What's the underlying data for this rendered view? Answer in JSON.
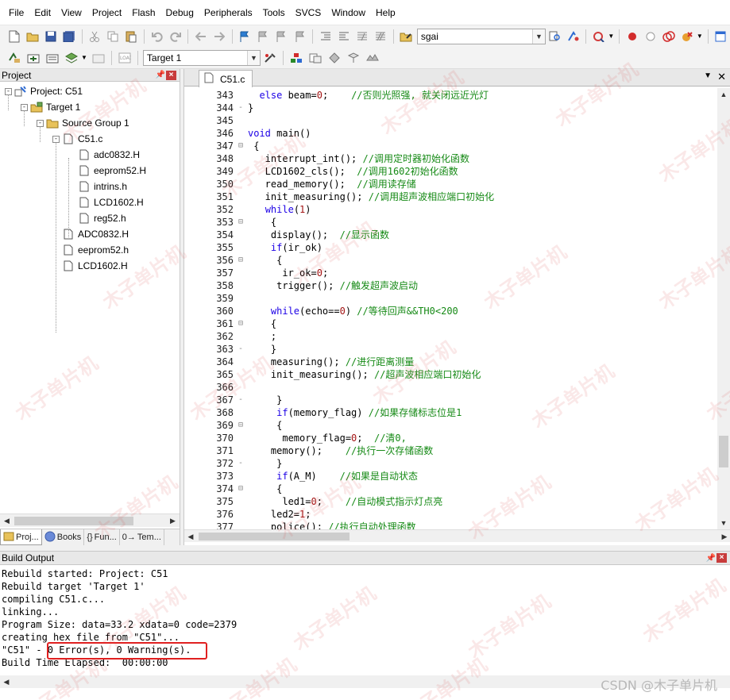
{
  "menu": [
    "File",
    "Edit",
    "View",
    "Project",
    "Flash",
    "Debug",
    "Peripherals",
    "Tools",
    "SVCS",
    "Window",
    "Help"
  ],
  "toolbar": {
    "find_combo": "sgai",
    "target_combo": "Target 1"
  },
  "project_panel": {
    "title": "Project",
    "tree": [
      {
        "label": "Project: C51",
        "icon": "project-icon",
        "expander": "-"
      },
      {
        "label": "Target 1",
        "icon": "target-icon",
        "expander": "-"
      },
      {
        "label": "Source Group 1",
        "icon": "folder-icon",
        "expander": "-"
      },
      {
        "label": "C51.c",
        "icon": "file-icon",
        "expander": "-"
      },
      {
        "label": "adc0832.H",
        "icon": "file-icon"
      },
      {
        "label": "eeprom52.H",
        "icon": "file-icon"
      },
      {
        "label": "intrins.h",
        "icon": "file-icon"
      },
      {
        "label": "LCD1602.H",
        "icon": "file-icon"
      },
      {
        "label": "reg52.h",
        "icon": "file-icon"
      },
      {
        "label": "ADC0832.H",
        "icon": "file-icon"
      },
      {
        "label": "eeprom52.h",
        "icon": "file-icon"
      },
      {
        "label": "LCD1602.H",
        "icon": "file-icon"
      }
    ],
    "tabs": [
      {
        "label": "Proj...",
        "icon": "project-tab-icon"
      },
      {
        "label": "Books",
        "icon": "books-icon"
      },
      {
        "label": "Fun...",
        "icon": "functions-icon",
        "glyph": "{}"
      },
      {
        "label": "Tem...",
        "icon": "templates-icon",
        "glyph": "0→"
      }
    ]
  },
  "editor": {
    "tab": "C51.c",
    "lines": [
      {
        "n": "343",
        "fold": "",
        "code": [
          {
            "t": "  "
          },
          {
            "t": "else",
            "c": "kw"
          },
          {
            "t": " beam="
          },
          {
            "t": "0",
            "c": "num"
          },
          {
            "t": ";    "
          },
          {
            "t": "//否则光照强, 就关闭远近光灯",
            "c": "cm"
          }
        ]
      },
      {
        "n": "344",
        "fold": "-",
        "code": [
          {
            "t": "}"
          }
        ]
      },
      {
        "n": "345",
        "fold": "",
        "code": []
      },
      {
        "n": "346",
        "fold": "",
        "code": [
          {
            "t": "void",
            "c": "kw"
          },
          {
            "t": " main()"
          }
        ]
      },
      {
        "n": "347",
        "fold": "⊟",
        "code": [
          {
            "t": " {"
          }
        ]
      },
      {
        "n": "348",
        "fold": "",
        "code": [
          {
            "t": "   interrupt_int(); "
          },
          {
            "t": "//调用定时器初始化函数",
            "c": "cm"
          }
        ]
      },
      {
        "n": "349",
        "fold": "",
        "code": [
          {
            "t": "   LCD1602_cls();  "
          },
          {
            "t": "//调用1602初始化函数",
            "c": "cm"
          }
        ]
      },
      {
        "n": "350",
        "fold": "",
        "code": [
          {
            "t": "   read_memory();  "
          },
          {
            "t": "//调用读存储",
            "c": "cm"
          }
        ]
      },
      {
        "n": "351",
        "fold": "",
        "code": [
          {
            "t": "   init_measuring(); "
          },
          {
            "t": "//调用超声波相应端口初始化",
            "c": "cm"
          }
        ]
      },
      {
        "n": "352",
        "fold": "",
        "code": [
          {
            "t": "   "
          },
          {
            "t": "while",
            "c": "kw"
          },
          {
            "t": "("
          },
          {
            "t": "1",
            "c": "num"
          },
          {
            "t": ")"
          }
        ]
      },
      {
        "n": "353",
        "fold": "⊟",
        "code": [
          {
            "t": "    {"
          }
        ]
      },
      {
        "n": "354",
        "fold": "",
        "code": [
          {
            "t": "    display();  "
          },
          {
            "t": "//显示函数",
            "c": "cm"
          }
        ]
      },
      {
        "n": "355",
        "fold": "",
        "code": [
          {
            "t": "    "
          },
          {
            "t": "if",
            "c": "kw"
          },
          {
            "t": "(ir_ok)"
          }
        ]
      },
      {
        "n": "356",
        "fold": "⊟",
        "code": [
          {
            "t": "     {"
          }
        ]
      },
      {
        "n": "357",
        "fold": "",
        "code": [
          {
            "t": "      ir_ok="
          },
          {
            "t": "0",
            "c": "num"
          },
          {
            "t": ";"
          }
        ]
      },
      {
        "n": "358",
        "fold": "",
        "code": [
          {
            "t": "     trigger(); "
          },
          {
            "t": "//触发超声波启动",
            "c": "cm"
          }
        ]
      },
      {
        "n": "359",
        "fold": "",
        "code": []
      },
      {
        "n": "360",
        "fold": "",
        "code": [
          {
            "t": "    "
          },
          {
            "t": "while",
            "c": "kw"
          },
          {
            "t": "(echo=="
          },
          {
            "t": "0",
            "c": "num"
          },
          {
            "t": ") "
          },
          {
            "t": "//等待回声&&TH0<200",
            "c": "cm"
          }
        ]
      },
      {
        "n": "361",
        "fold": "⊟",
        "code": [
          {
            "t": "    {"
          }
        ]
      },
      {
        "n": "362",
        "fold": "",
        "code": [
          {
            "t": "    ;"
          }
        ]
      },
      {
        "n": "363",
        "fold": "-",
        "code": [
          {
            "t": "    }"
          }
        ]
      },
      {
        "n": "364",
        "fold": "",
        "code": [
          {
            "t": "    measuring(); "
          },
          {
            "t": "//进行距离测量",
            "c": "cm"
          }
        ]
      },
      {
        "n": "365",
        "fold": "",
        "code": [
          {
            "t": "    init_measuring(); "
          },
          {
            "t": "//超声波相应端口初始化",
            "c": "cm"
          }
        ]
      },
      {
        "n": "366",
        "fold": "",
        "code": []
      },
      {
        "n": "367",
        "fold": "-",
        "code": [
          {
            "t": "     }"
          }
        ]
      },
      {
        "n": "368",
        "fold": "",
        "code": [
          {
            "t": "     "
          },
          {
            "t": "if",
            "c": "kw"
          },
          {
            "t": "(memory_flag) "
          },
          {
            "t": "//如果存储标志位是1",
            "c": "cm"
          }
        ]
      },
      {
        "n": "369",
        "fold": "⊟",
        "code": [
          {
            "t": "     {"
          }
        ]
      },
      {
        "n": "370",
        "fold": "",
        "code": [
          {
            "t": "      memory_flag="
          },
          {
            "t": "0",
            "c": "num"
          },
          {
            "t": ";  "
          },
          {
            "t": "//清0,",
            "c": "cm"
          }
        ]
      },
      {
        "n": "371",
        "fold": "",
        "code": [
          {
            "t": "    memory();    "
          },
          {
            "t": "//执行一次存储函数",
            "c": "cm"
          }
        ]
      },
      {
        "n": "372",
        "fold": "-",
        "code": [
          {
            "t": "     }"
          }
        ]
      },
      {
        "n": "373",
        "fold": "",
        "code": [
          {
            "t": "     "
          },
          {
            "t": "if",
            "c": "kw"
          },
          {
            "t": "(A_M)    "
          },
          {
            "t": "//如果是自动状态",
            "c": "cm"
          }
        ]
      },
      {
        "n": "374",
        "fold": "⊟",
        "code": [
          {
            "t": "     {"
          }
        ]
      },
      {
        "n": "375",
        "fold": "",
        "code": [
          {
            "t": "      led1="
          },
          {
            "t": "0",
            "c": "num"
          },
          {
            "t": ";    "
          },
          {
            "t": "//自动模式指示灯点亮",
            "c": "cm"
          }
        ]
      },
      {
        "n": "376",
        "fold": "",
        "code": [
          {
            "t": "    led2="
          },
          {
            "t": "1",
            "c": "num"
          },
          {
            "t": ";"
          }
        ]
      },
      {
        "n": "377",
        "fold": "",
        "code": [
          {
            "t": "    police(); "
          },
          {
            "t": "//执行自动处理函数",
            "c": "cm"
          }
        ]
      }
    ]
  },
  "build_output": {
    "title": "Build Output",
    "lines": [
      "Rebuild started: Project: C51",
      "Rebuild target 'Target 1'",
      "compiling C51.c...",
      "linking...",
      "Program Size: data=33.2 xdata=0 code=2379",
      "creating hex file from \"C51\"...",
      "\"C51\" - 0 Error(s), 0 Warning(s).",
      "Build Time Elapsed:  00:00:00"
    ]
  },
  "watermark": {
    "text": "木子单片机",
    "csdn": "CSDN @木子单片机"
  },
  "colors": {
    "keyword": "#1c00e6",
    "comment": "#168a16",
    "number": "#a31515",
    "highlight_box": "#e02020"
  }
}
